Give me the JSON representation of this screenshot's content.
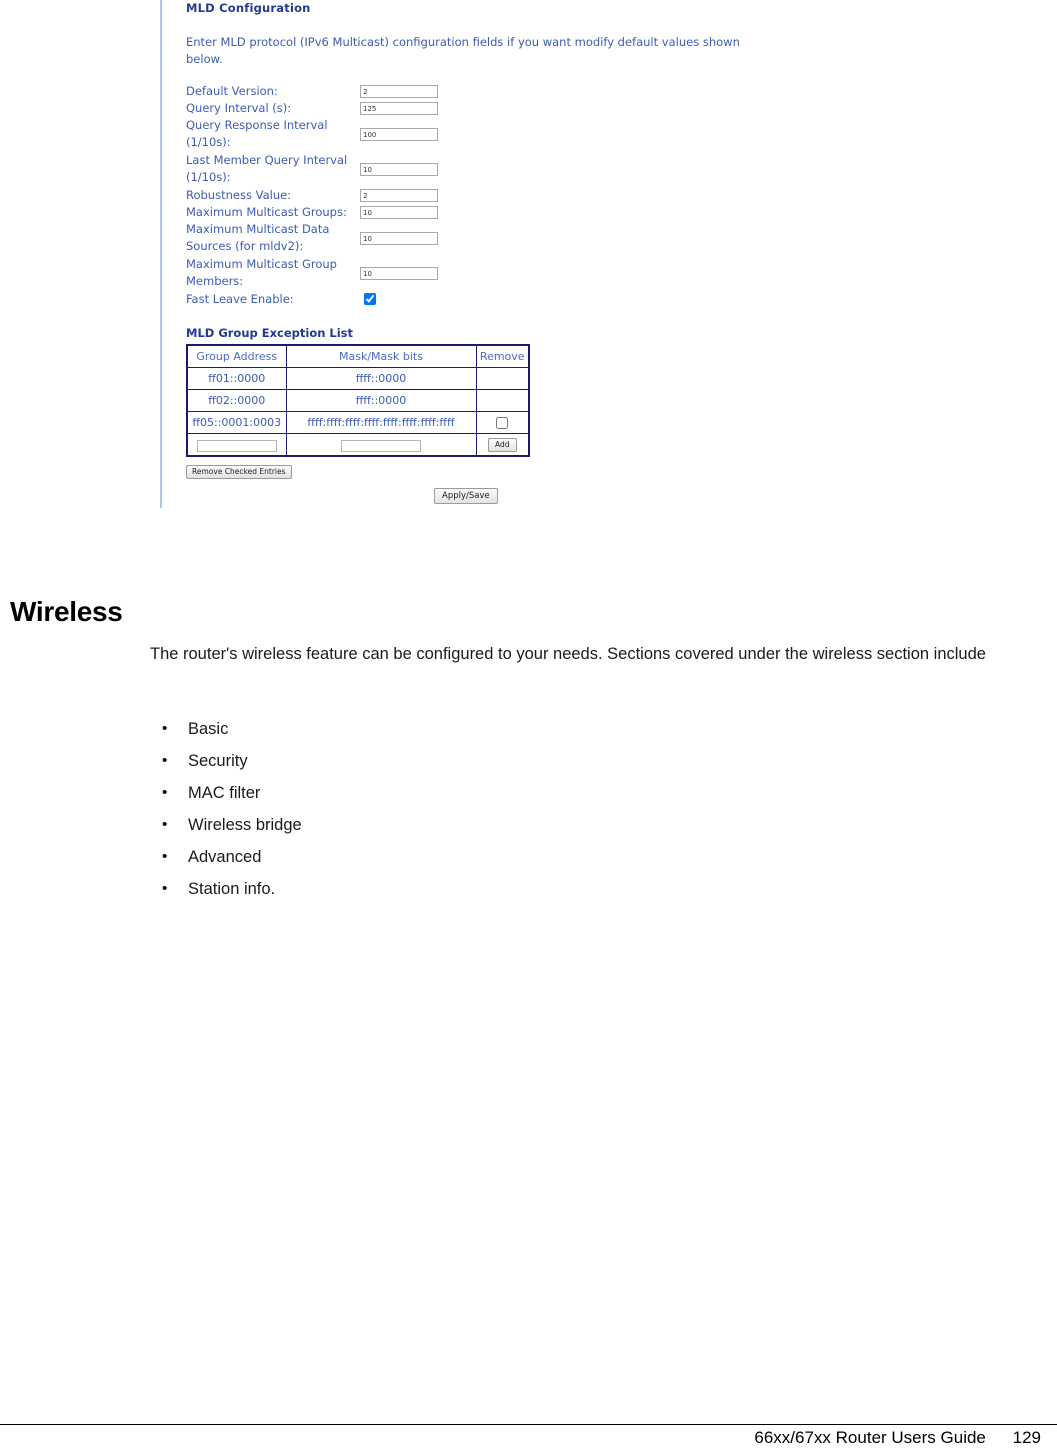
{
  "router_ui": {
    "config_title": "MLD Configuration",
    "config_description": "Enter MLD protocol (IPv6 Multicast) configuration fields if you want modify default values shown below.",
    "fields": [
      {
        "label": "Default Version:",
        "value": "2",
        "type": "text"
      },
      {
        "label": "Query Interval (s):",
        "value": "125",
        "type": "text"
      },
      {
        "label": "Query Response Interval (1/10s):",
        "value": "100",
        "type": "text"
      },
      {
        "label": "Last Member Query Interval (1/10s):",
        "value": "10",
        "type": "text"
      },
      {
        "label": "Robustness Value:",
        "value": "2",
        "type": "text"
      },
      {
        "label": "Maximum Multicast Groups:",
        "value": "10",
        "type": "text"
      },
      {
        "label": "Maximum Multicast Data Sources (for mldv2):",
        "value": "10",
        "type": "text"
      },
      {
        "label": "Maximum Multicast Group Members:",
        "value": "10",
        "type": "text"
      },
      {
        "label": "Fast Leave Enable:",
        "value": "checked",
        "type": "checkbox"
      }
    ],
    "exception_list": {
      "title": "MLD Group Exception List",
      "columns": [
        "Group Address",
        "Mask/Mask bits",
        "Remove"
      ],
      "rows": [
        {
          "group_address": "ff01::0000",
          "mask": "ffff::0000",
          "remove": "none"
        },
        {
          "group_address": "ff02::0000",
          "mask": "ffff::0000",
          "remove": "none"
        },
        {
          "group_address": "ff05::0001:0003",
          "mask": "ffff:ffff:ffff:ffff:ffff:ffff:ffff:ffff",
          "remove": "checkbox"
        }
      ],
      "new_row": {
        "group_address_value": "",
        "mask_value": "",
        "add_label": "Add"
      },
      "remove_checked_label": "Remove Checked Entries"
    },
    "apply_save_label": "Apply/Save",
    "accent_heading_color": "#223a8f",
    "accent_label_color": "#3c5bb5",
    "rail_color": "#a8c6ea"
  },
  "document": {
    "heading": "Wireless",
    "paragraph": "The router's wireless feature can be configured to your needs. Sections covered under the wireless section include",
    "bullets": [
      "Basic",
      "Security",
      "MAC filter",
      "Wireless bridge",
      "Advanced",
      "Station info."
    ]
  },
  "footer": {
    "guide_title": "66xx/67xx Router Users Guide",
    "page_number": "129"
  }
}
